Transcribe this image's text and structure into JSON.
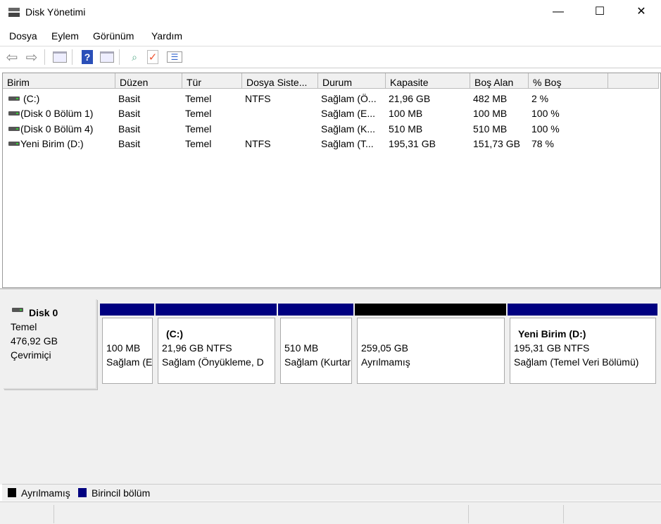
{
  "window": {
    "title": "Disk Yönetimi",
    "minimize": "—",
    "maximize": "☐",
    "close": "✕"
  },
  "menu": [
    "Dosya",
    "Eylem",
    "Görünüm",
    "Yardım"
  ],
  "columns": [
    "Birim",
    "Düzen",
    "Tür",
    "Dosya Siste...",
    "Durum",
    "Kapasite",
    "Boş Alan",
    "% Boş"
  ],
  "volumes": [
    [
      "(C:)",
      "Basit",
      "Temel",
      "NTFS",
      "Sağlam (Ö...",
      "21,96 GB",
      "482 MB",
      "2 %"
    ],
    [
      "(Disk 0 Bölüm 1)",
      "Basit",
      "Temel",
      "",
      "Sağlam (E...",
      "100 MB",
      "100 MB",
      "100 %"
    ],
    [
      "(Disk 0 Bölüm 4)",
      "Basit",
      "Temel",
      "",
      "Sağlam (K...",
      "510 MB",
      "510 MB",
      "100 %"
    ],
    [
      "Yeni Birim (D:)",
      "Basit",
      "Temel",
      "NTFS",
      "Sağlam (T...",
      "195,31 GB",
      "151,73 GB",
      "78 %"
    ]
  ],
  "disk": {
    "name": "Disk 0",
    "type": "Temel",
    "size": "476,92 GB",
    "status": "Çevrimiçi"
  },
  "partitions": [
    {
      "title": "",
      "size": "100 MB",
      "status": "Sağlam (E",
      "kind": "primary"
    },
    {
      "title": "(C:)",
      "size": "21,96 GB NTFS",
      "status": "Sağlam (Önyükleme, D",
      "kind": "primary"
    },
    {
      "title": "",
      "size": "510 MB",
      "status": "Sağlam (Kurtarma",
      "kind": "primary"
    },
    {
      "title": "",
      "size": "259,05 GB",
      "status": "Ayrılmamış",
      "kind": "unallocated"
    },
    {
      "title": "Yeni Birim  (D:)",
      "size": "195,31 GB NTFS",
      "status": "Sağlam (Temel Veri Bölümü)",
      "kind": "primary"
    }
  ],
  "legend": [
    {
      "label": "Ayrılmamış",
      "color": "#000000"
    },
    {
      "label": "Birincil bölüm",
      "color": "#000080"
    }
  ],
  "colors": {
    "primary": "#000080",
    "unallocated": "#000000"
  }
}
